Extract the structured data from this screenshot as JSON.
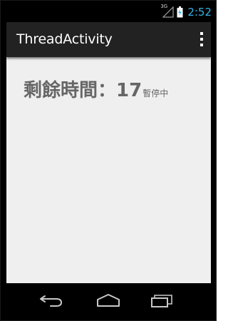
{
  "status_bar": {
    "network_label": "3G",
    "time": "2:52",
    "clock_color": "#33b5e5",
    "icons": [
      "signal-icon",
      "battery-charging-icon"
    ]
  },
  "action_bar": {
    "title": "ThreadActivity",
    "overflow_icon": "overflow-menu-icon"
  },
  "main": {
    "countdown_label": "剩餘時間：",
    "countdown_value": "17",
    "status_text": "暫停中"
  },
  "nav_bar": {
    "icons": [
      "back-icon",
      "home-icon",
      "recent-apps-icon"
    ]
  }
}
